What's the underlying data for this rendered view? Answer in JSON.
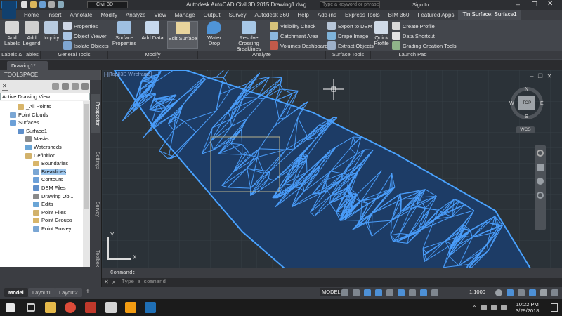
{
  "window": {
    "app_menu_label": "Civil 3D",
    "title": "Autodesk AutoCAD Civil 3D 2015    Drawing1.dwg",
    "search_placeholder": "Type a keyword or phrase",
    "sign_in": "Sign In"
  },
  "menu": [
    "Home",
    "Insert",
    "Annotate",
    "Modify",
    "Analyze",
    "View",
    "Manage",
    "Output",
    "Survey",
    "Autodesk 360",
    "Help",
    "Add-ins",
    "Express Tools",
    "BIM 360",
    "Featured Apps",
    "Tin Surface: Surface1"
  ],
  "ribbon": {
    "add_labels": "Add Labels",
    "add_legend": "Add Legend",
    "inquiry": "Inquiry",
    "properties": "Properties",
    "object_viewer": "Object Viewer",
    "isolate_objects": "Isolate Objects",
    "surface_properties": "Surface Properties",
    "add_data": "Add Data",
    "edit_surface": "Edit Surface",
    "water_drop": "Water Drop",
    "resolve_crossing": "Resolve Crossing Breaklines",
    "visibility_check": "Visibility Check",
    "catchment_area": "Catchment Area",
    "volumes_dashboard": "Volumes Dashboard",
    "export_dem": "Export to DEM",
    "drape_image": "Drape Image",
    "extract_objects": "Extract Objects",
    "quick_profile": "Quick Profile",
    "create_profile": "Create Profile",
    "data_shortcut": "Data Shortcut",
    "grading_creation_tools": "Grading Creation Tools",
    "groups": {
      "labels_tables": "Labels & Tables",
      "general_tools": "General Tools",
      "modify": "Modify",
      "analyze": "Analyze",
      "surface_tools": "Surface Tools",
      "launch_pad": "Launch Pad"
    }
  },
  "doc_tab": "Drawing1*",
  "toolspace": {
    "title": "TOOLSPACE",
    "view": "Active Drawing View",
    "side_tabs": [
      "Prospector",
      "Settings",
      "Survey",
      "Toolbox"
    ],
    "tree": [
      {
        "label": "_All Points",
        "indent": 3
      },
      {
        "label": "Point Clouds",
        "indent": 2
      },
      {
        "label": "Surfaces",
        "indent": 2
      },
      {
        "label": "Surface1",
        "indent": 3
      },
      {
        "label": "Masks",
        "indent": 4
      },
      {
        "label": "Watersheds",
        "indent": 4
      },
      {
        "label": "Definition",
        "indent": 4
      },
      {
        "label": "Boundaries",
        "indent": 5
      },
      {
        "label": "Breaklines",
        "indent": 5,
        "selected": true
      },
      {
        "label": "Contours",
        "indent": 5
      },
      {
        "label": "DEM Files",
        "indent": 5
      },
      {
        "label": "Drawing Obj...",
        "indent": 5
      },
      {
        "label": "Edits",
        "indent": 5
      },
      {
        "label": "Point Files",
        "indent": 5
      },
      {
        "label": "Point Groups",
        "indent": 5
      },
      {
        "label": "Point Survey ...",
        "indent": 5
      }
    ]
  },
  "viewport": {
    "label": "[-][Top][3D Wireframe]",
    "compass": {
      "n": "N",
      "s": "S",
      "e": "E",
      "w": "W",
      "top": "TOP",
      "wcs": "WCS"
    },
    "axis_y": "Y",
    "axis_x": "X"
  },
  "command": {
    "history": "Command:",
    "placeholder": "Type a command"
  },
  "layout_tabs": [
    "Model",
    "Layout1",
    "Layout2"
  ],
  "status": {
    "model": "MODEL",
    "scale": "1:1000"
  },
  "clock": {
    "time": "10:22 PM",
    "date": "3/29/2018"
  }
}
